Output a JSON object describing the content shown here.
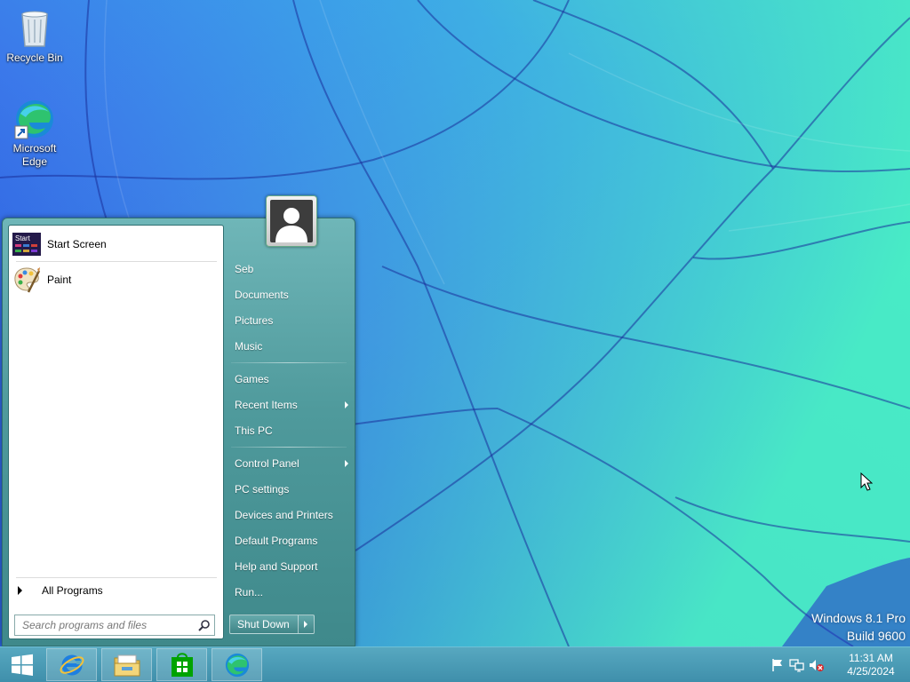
{
  "desktop": {
    "icons": [
      {
        "label": "Recycle Bin",
        "icon": "recycle-bin-icon"
      },
      {
        "label": "Microsoft Edge",
        "icon": "edge-icon"
      }
    ],
    "watermark": {
      "line1": "Windows 8.1 Pro",
      "line2": "Build 9600"
    }
  },
  "start_menu": {
    "pinned": [
      {
        "label": "Start Screen",
        "icon": "start-screen-icon",
        "icon_text": "Start"
      },
      {
        "label": "Paint",
        "icon": "paint-palette-icon"
      }
    ],
    "all_programs": "All Programs",
    "search_placeholder": "Search programs and files",
    "user_name": "Seb",
    "right_items": [
      {
        "label": "Seb"
      },
      {
        "label": "Documents"
      },
      {
        "label": "Pictures"
      },
      {
        "label": "Music"
      },
      {
        "label": "Games"
      },
      {
        "label": "Recent Items",
        "submenu": true
      },
      {
        "label": "This PC"
      },
      {
        "label": "Control Panel",
        "submenu": true
      },
      {
        "label": "PC settings"
      },
      {
        "label": "Devices and Printers"
      },
      {
        "label": "Default Programs"
      },
      {
        "label": "Help and Support"
      },
      {
        "label": "Run..."
      }
    ],
    "shutdown_label": "Shut Down"
  },
  "taskbar": {
    "pinned": [
      {
        "name": "Internet Explorer",
        "icon": "internet-explorer-icon"
      },
      {
        "name": "File Explorer",
        "icon": "file-explorer-icon"
      },
      {
        "name": "Store",
        "icon": "store-icon"
      },
      {
        "name": "Microsoft Edge",
        "icon": "edge-icon"
      }
    ],
    "tray_icons": [
      "action-center-flag-icon",
      "network-icon",
      "volume-muted-icon"
    ],
    "clock": {
      "time": "11:31 AM",
      "date": "4/25/2024"
    }
  },
  "colors": {
    "start_menu_glass": "#4f9a9c",
    "taskbar": "#4a9ab5",
    "wallpaper_blue": "#2f63e6",
    "wallpaper_teal": "#38e0d8"
  }
}
